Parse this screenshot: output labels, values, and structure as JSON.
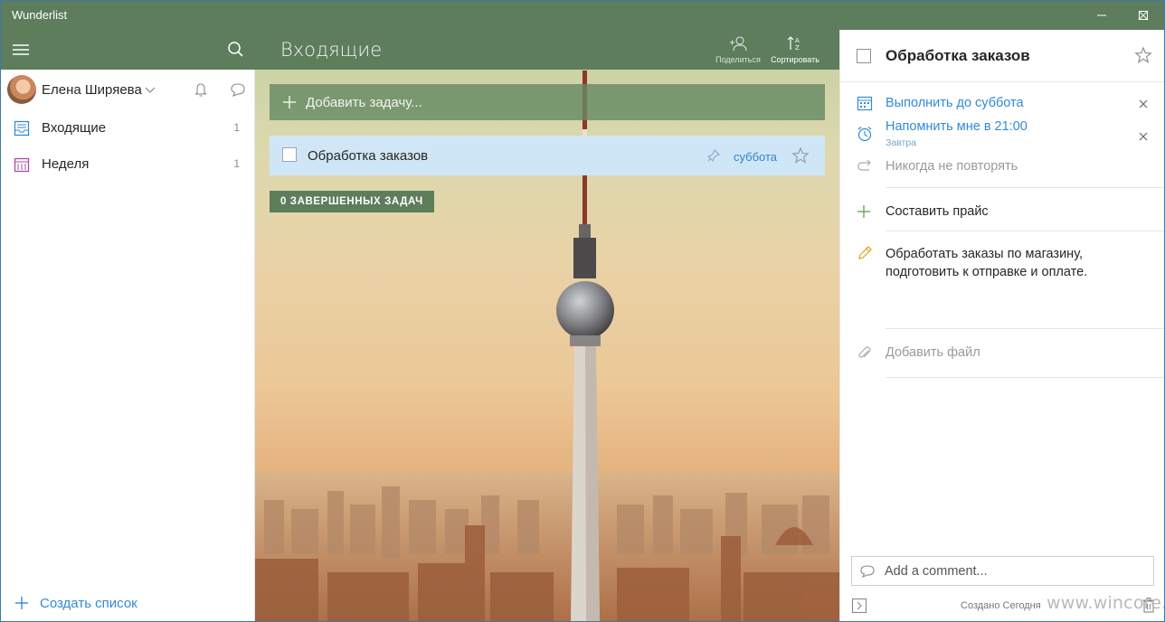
{
  "window": {
    "title": "Wunderlist",
    "accent": "#5d7d5c"
  },
  "sidebar": {
    "user_name": "Елена Ширяева",
    "items": [
      {
        "label": "Входящие",
        "count": "1",
        "icon": "inbox-icon"
      },
      {
        "label": "Неделя",
        "count": "1",
        "icon": "calendar-week-icon"
      }
    ],
    "create_list_label": "Создать список"
  },
  "main": {
    "list_title": "Входящие",
    "share_label": "Поделиться",
    "sort_label": "Сортировать",
    "add_task_label": "Добавить задачу...",
    "tasks": [
      {
        "title": "Обработка заказов",
        "due": "суббота",
        "starred": false
      }
    ],
    "completed_label": "0 ЗАВЕРШЕННЫХ ЗАДАЧ"
  },
  "detail": {
    "task_title": "Обработка заказов",
    "due_label": "Выполнить до суббота",
    "reminder_label": "Напомнить мне в 21:00",
    "reminder_sub": "Завтра",
    "repeat_label": "Никогда не повторять",
    "subtask_label": "Составить прайс",
    "note_text": "Обработать заказы по магазину,\nподготовить к отправке и оплате.",
    "add_file_label": "Добавить файл",
    "comment_placeholder": "Add a comment...",
    "created_label": "Создано Сегодня"
  },
  "watermark": "www.wincore.ru",
  "colors": {
    "link_blue": "#328ad6",
    "selected_row": "#cfe6f6"
  }
}
